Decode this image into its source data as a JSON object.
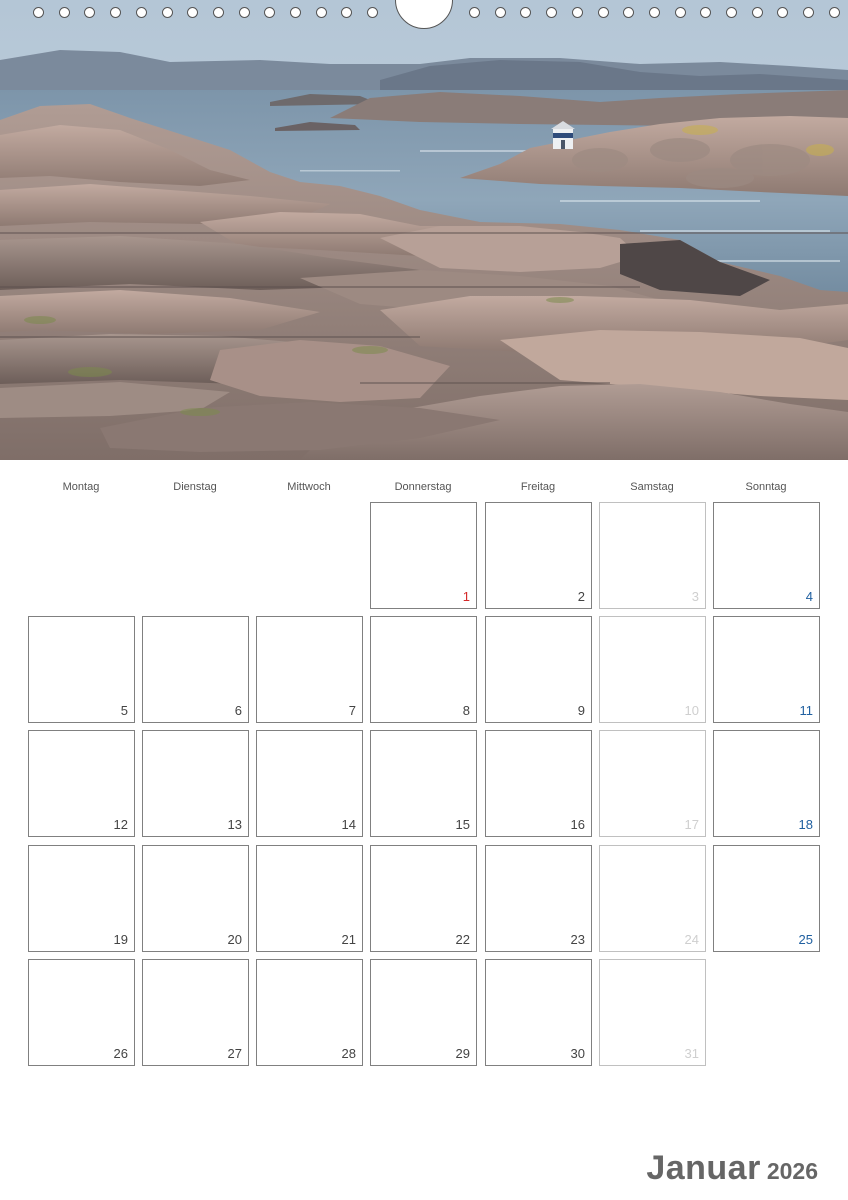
{
  "photo": {
    "description_icon": "coastal-rocks-lighthouse-photo"
  },
  "calendar": {
    "weekdays": [
      "Montag",
      "Dienstag",
      "Mittwoch",
      "Donnerstag",
      "Freitag",
      "Samstag",
      "Sonntag"
    ],
    "weeks": [
      [
        null,
        null,
        null,
        "1",
        "2",
        "3",
        "4"
      ],
      [
        "5",
        "6",
        "7",
        "8",
        "9",
        "10",
        "11"
      ],
      [
        "12",
        "13",
        "14",
        "15",
        "16",
        "17",
        "18"
      ],
      [
        "19",
        "20",
        "21",
        "22",
        "23",
        "24",
        "25"
      ],
      [
        "26",
        "27",
        "28",
        "29",
        "30",
        "31",
        null
      ]
    ],
    "holidays": [
      "1"
    ]
  },
  "title": {
    "month": "Januar",
    "year": "2026"
  },
  "colors": {
    "sunday": "#2060a0",
    "holiday": "#d42a2a",
    "saturday": "#cfcfcf",
    "weekday": "#444444",
    "title": "#666666"
  }
}
